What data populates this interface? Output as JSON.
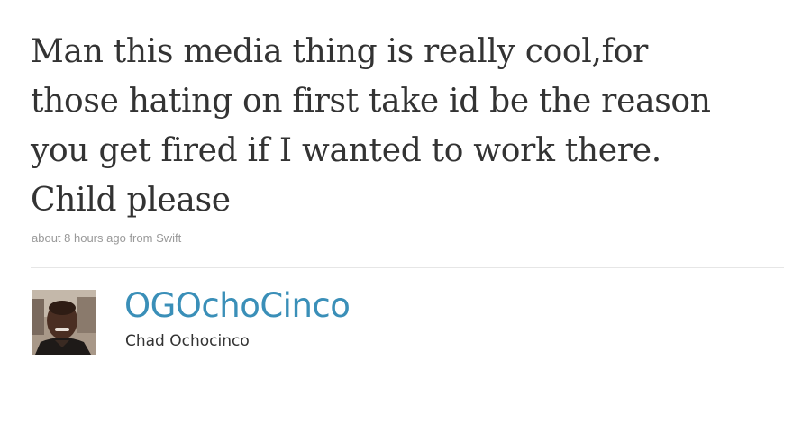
{
  "tweet": {
    "text": "Man this media thing is really cool,for those hating on first take id be the reason you get fired if I wanted to work there. Child please",
    "timestamp": "about 8 hours ago",
    "source_prefix": "from",
    "source": "Swift"
  },
  "author": {
    "screen_name": "OGOchoCinco",
    "full_name": "Chad Ochocinco",
    "avatar_icon": "profile-photo"
  },
  "colors": {
    "link": "#3a8fb8",
    "text": "#333333",
    "meta": "#999999",
    "divider": "#e6e6e6"
  }
}
